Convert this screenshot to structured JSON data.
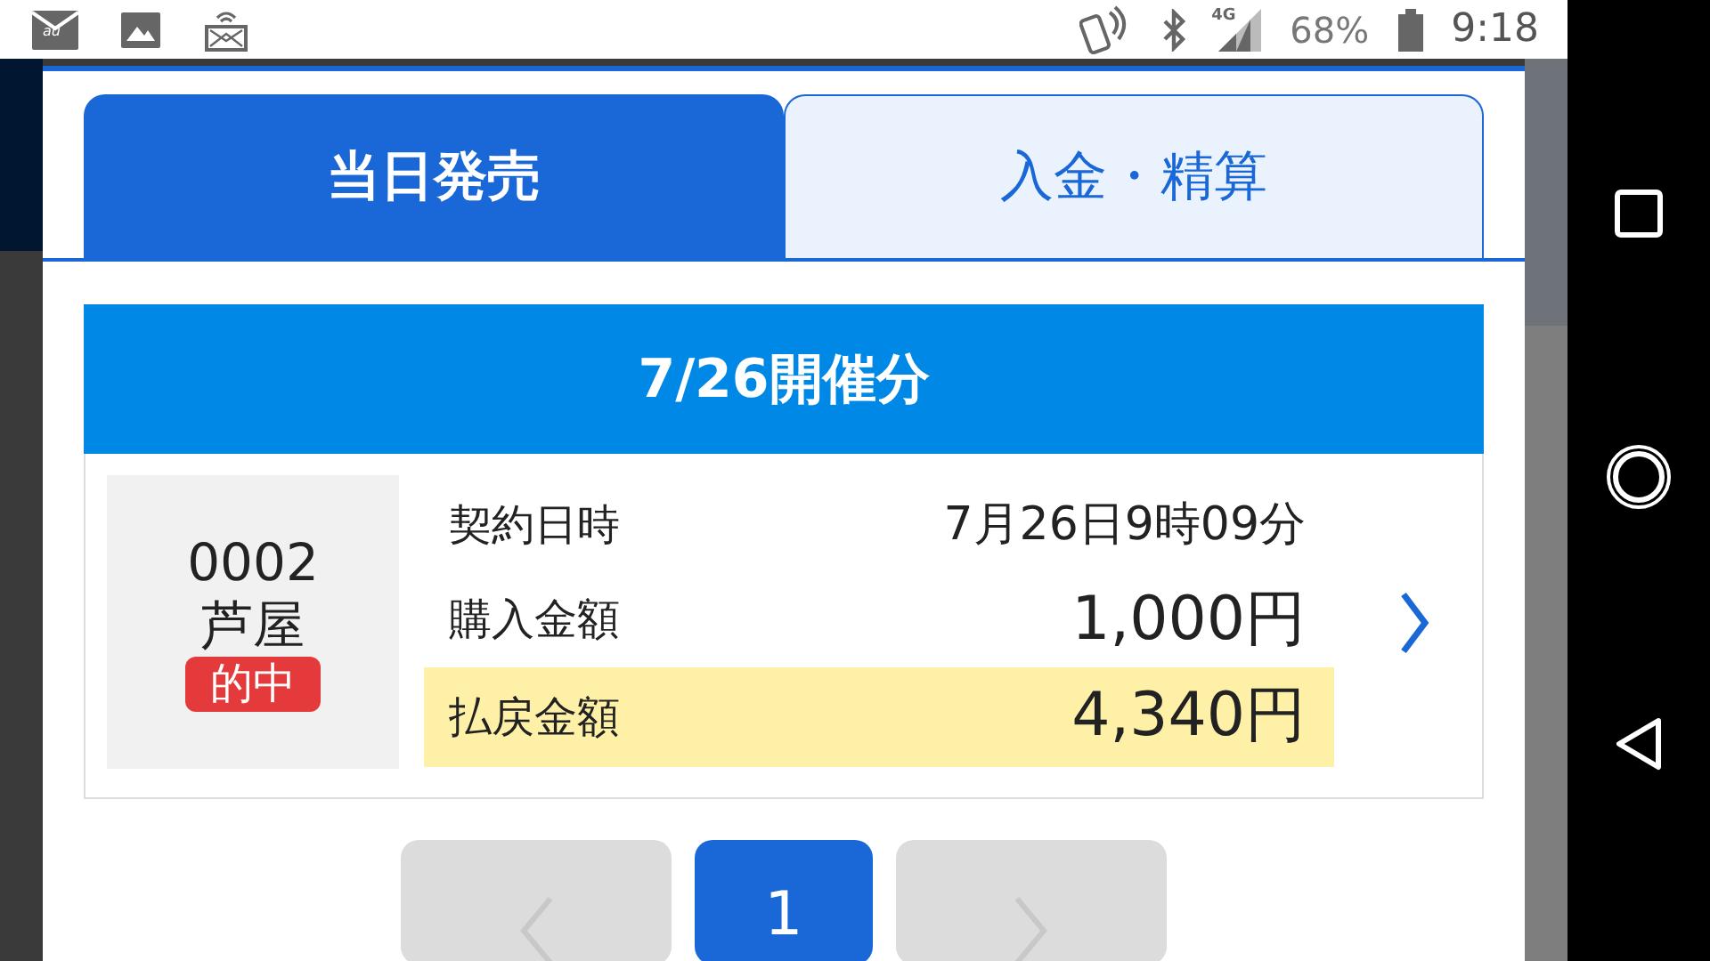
{
  "status_bar": {
    "mail_label": "au",
    "network": "4G",
    "battery": "68%",
    "time": "9:18"
  },
  "tabs": [
    {
      "label": "当日発売",
      "selected": true
    },
    {
      "label": "入金・精算",
      "selected": false
    }
  ],
  "section_title": "7/26開催分",
  "tickets": [
    {
      "number": "0002",
      "venue": "芦屋",
      "result": "的中",
      "rows": [
        {
          "kind": "datetime",
          "label": "契約日時",
          "value": "7月26日9時09分",
          "highlighted": false
        },
        {
          "kind": "amount",
          "label": "購入金額",
          "value": "1,000円",
          "highlighted": false
        },
        {
          "kind": "amount",
          "label": "払戻金額",
          "value": "4,340円",
          "highlighted": true
        }
      ]
    }
  ],
  "pagination": {
    "prev_disabled": true,
    "next_disabled": true,
    "pages": [
      {
        "label": "1",
        "selected": true
      }
    ]
  }
}
